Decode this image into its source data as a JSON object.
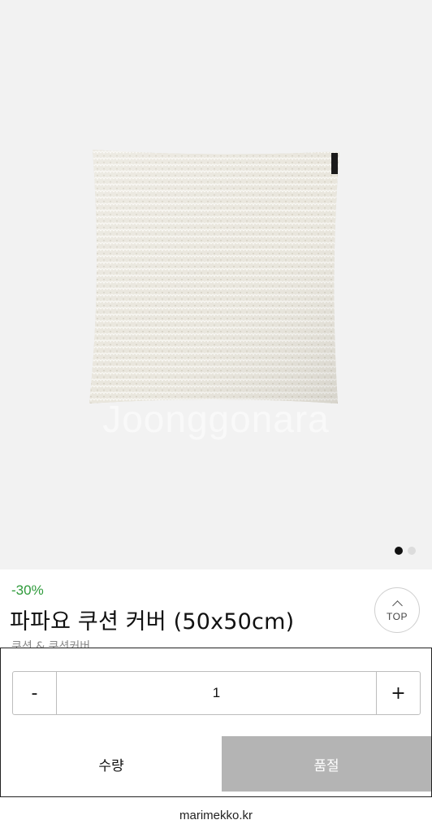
{
  "product": {
    "discount": "-30%",
    "title": "파파요 쿠션 커버 (50x50cm)",
    "category": "쿠션 & 쿠션커버",
    "watermark": "Joonggonara"
  },
  "gallery": {
    "total_images": 2,
    "active_index": 0
  },
  "top_button": {
    "label": "TOP",
    "icon": "chevron-up-icon"
  },
  "purchase": {
    "minus_label": "-",
    "plus_label": "+",
    "quantity": "1",
    "quantity_label": "수량",
    "soldout_label": "품절"
  },
  "footer": {
    "domain": "marimekko.kr"
  },
  "colors": {
    "discount": "#2e9a3a",
    "soldout_bg": "#b4b4b4",
    "pillow": "#d8d4c8"
  }
}
